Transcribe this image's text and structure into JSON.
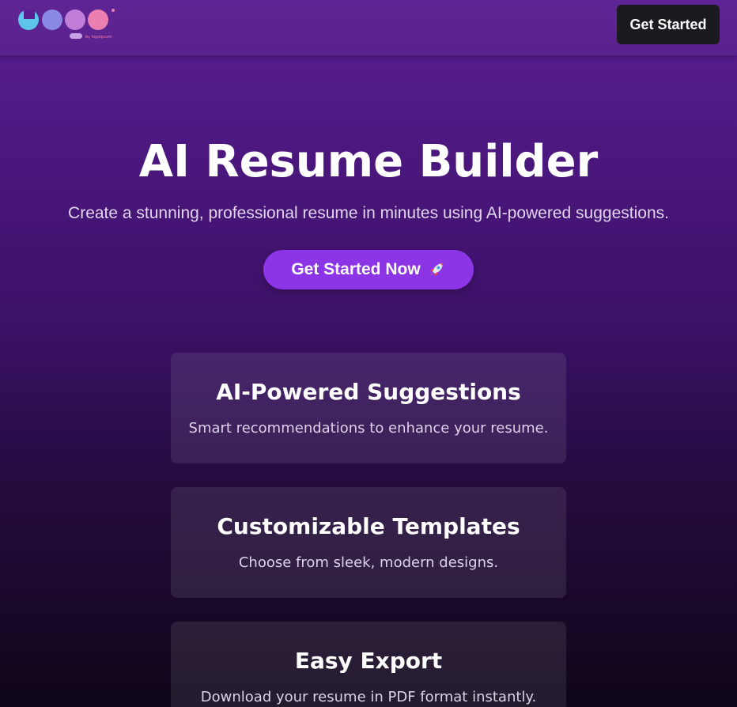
{
  "header": {
    "logo_icon": "logo-mark",
    "logo_text": "by logoipsum",
    "cta_label": "Get Started"
  },
  "hero": {
    "title": "AI Resume Builder",
    "subtitle": "Create a stunning, professional resume in minutes using AI-powered suggestions.",
    "cta_label": "Get Started Now",
    "cta_icon": "rocket-icon"
  },
  "features": [
    {
      "title": "AI-Powered Suggestions",
      "description": "Smart recommendations to enhance your resume."
    },
    {
      "title": "Customizable Templates",
      "description": "Choose from sleek, modern designs."
    },
    {
      "title": "Easy Export",
      "description": "Download your resume in PDF format instantly."
    }
  ],
  "colors": {
    "background_top": "#5a1d92",
    "background_bottom": "#0f0619",
    "cta_accent": "#8b35e6",
    "header_button": "#1b1b1f"
  }
}
